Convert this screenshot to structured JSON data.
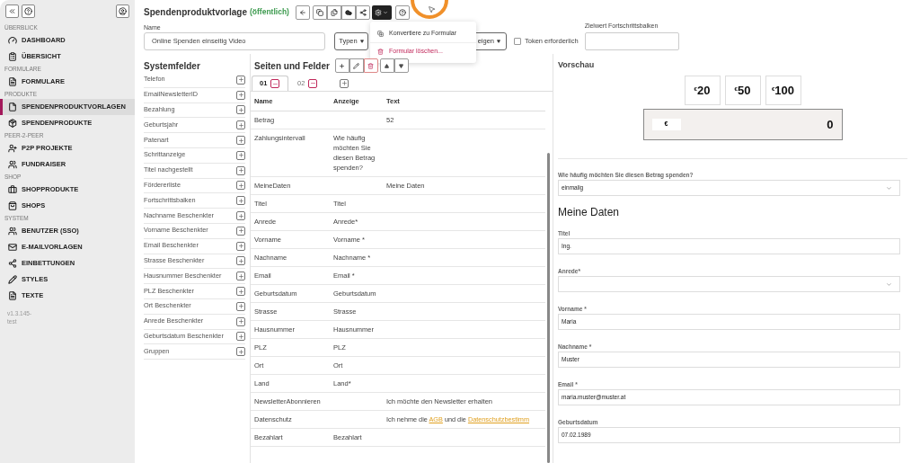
{
  "sidebar": {
    "sections": [
      {
        "title": "ÜBERBLICK",
        "items": [
          {
            "label": "DASHBOARD",
            "selected": false
          },
          {
            "label": "ÜBERSICHT",
            "selected": false
          }
        ]
      },
      {
        "title": "FORMULARE",
        "items": [
          {
            "label": "FORMULARE",
            "selected": false
          }
        ]
      },
      {
        "title": "PRODUKTE",
        "items": [
          {
            "label": "SPENDENPRODUKTVORLAGEN",
            "selected": true
          },
          {
            "label": "SPENDENPRODUKTE",
            "selected": false
          }
        ]
      },
      {
        "title": "PEER-2-PEER",
        "items": [
          {
            "label": "P2P PROJEKTE",
            "selected": false
          },
          {
            "label": "FUNDRAISER",
            "selected": false
          }
        ]
      },
      {
        "title": "SHOP",
        "items": [
          {
            "label": "SHOPPRODUKTE",
            "selected": false
          },
          {
            "label": "SHOPS",
            "selected": false
          }
        ]
      },
      {
        "title": "SYSTEM",
        "items": [
          {
            "label": "BENUTZER (SSO)",
            "selected": false
          },
          {
            "label": "E-MAILVORLAGEN",
            "selected": false
          },
          {
            "label": "EINBETTUNGEN",
            "selected": false
          },
          {
            "label": "STYLES",
            "selected": false
          },
          {
            "label": "TEXTE",
            "selected": false
          }
        ]
      }
    ],
    "version": "v1.3.145-test"
  },
  "header": {
    "title": "Spendenproduktvorlage",
    "status": "(öffentlich)",
    "menu": [
      {
        "label": "Konvertiere zu Formular",
        "kind": "normal"
      },
      {
        "label": "Formular löschen...",
        "kind": "danger"
      }
    ],
    "name_label": "Name",
    "name_value": "Online Spenden einseitig Video",
    "types_button": "Typen",
    "covered_button": "eigen",
    "token": {
      "label": "Token erforderlich",
      "checked": false
    },
    "target_label": "Zielwert Fortschrittsbalken"
  },
  "system_fields": {
    "title": "Systemfelder",
    "fields": [
      "Telefon",
      "EmailNewsletterID",
      "Bezahlung",
      "Geburtsjahr",
      "Patenart",
      "Schrittanzeige",
      "Titel nachgestellt",
      "Fördererliste",
      "Fortschrittsbalken",
      "Nachname Beschenkter",
      "Vorname Beschenkter",
      "Email Beschenkter",
      "Strasse Beschenkter",
      "Hausnummer Beschenkter",
      "PLZ Beschenkter",
      "Ort Beschenkter",
      "Anrede Beschenkter",
      "Geburtsdatum Beschenkter",
      "Gruppen"
    ]
  },
  "pages": {
    "title": "Seiten und Felder",
    "tabs": [
      {
        "label": "01",
        "selected": true
      },
      {
        "label": "02",
        "selected": false
      }
    ],
    "columns": [
      "Name",
      "Anzeige",
      "Text"
    ],
    "rows": [
      {
        "name": "Betrag",
        "text": "52"
      },
      {
        "name": "Zahlungsintervall",
        "display": "Wie häufig möchten Sie diesen Betrag spenden?"
      },
      {
        "name": "MeineDaten",
        "text": "Meine Daten"
      },
      {
        "name": "Titel",
        "display": "Titel"
      },
      {
        "name": "Anrede",
        "display": "Anrede*"
      },
      {
        "name": "Vorname",
        "display": "Vorname *"
      },
      {
        "name": "Nachname",
        "display": "Nachname *"
      },
      {
        "name": "Email",
        "display": "Email *"
      },
      {
        "name": "Geburtsdatum",
        "display": "Geburtsdatum"
      },
      {
        "name": "Strasse",
        "display": "Strasse"
      },
      {
        "name": "Hausnummer",
        "display": "Hausnummer"
      },
      {
        "name": "PLZ",
        "display": "PLZ"
      },
      {
        "name": "Ort",
        "display": "Ort"
      },
      {
        "name": "Land",
        "display": "Land*"
      },
      {
        "name": "NewsletterAbonnieren",
        "text": "Ich möchte den Newsletter erhalten"
      },
      {
        "name": "Datenschutz",
        "text_parts": [
          {
            "kind": "plain",
            "text": "Ich nehme die "
          },
          {
            "kind": "link",
            "text": "AGB"
          },
          {
            "kind": "plain",
            "text": " und die "
          },
          {
            "kind": "link",
            "text": "Datenschutzbestimm"
          }
        ]
      },
      {
        "name": "Bezahlart",
        "display": "Bezahlart"
      }
    ]
  },
  "preview": {
    "title": "Vorschau",
    "amounts": [
      {
        "currency": "€",
        "value": "20"
      },
      {
        "currency": "€",
        "value": "50"
      },
      {
        "currency": "€",
        "value": "100"
      }
    ],
    "custom_amount": {
      "currency": "€",
      "value": "0"
    },
    "fields": [
      {
        "kind": "select",
        "label": "Wie häufig möchten Sie diesen Betrag spenden?",
        "value": "einmalig"
      },
      {
        "kind": "heading",
        "label": "Meine Daten"
      },
      {
        "kind": "input",
        "label": "Titel",
        "value": "Ing."
      },
      {
        "kind": "select",
        "label": "Anrede*"
      },
      {
        "kind": "input",
        "label": "Vorname *",
        "value": "Maria"
      },
      {
        "kind": "input",
        "label": "Nachname *",
        "value": "Muster"
      },
      {
        "kind": "input",
        "label": "Email *",
        "value": "maria.muster@muster.at"
      },
      {
        "kind": "input",
        "label": "Geburtsdatum",
        "value": "07.02.1989"
      }
    ]
  }
}
